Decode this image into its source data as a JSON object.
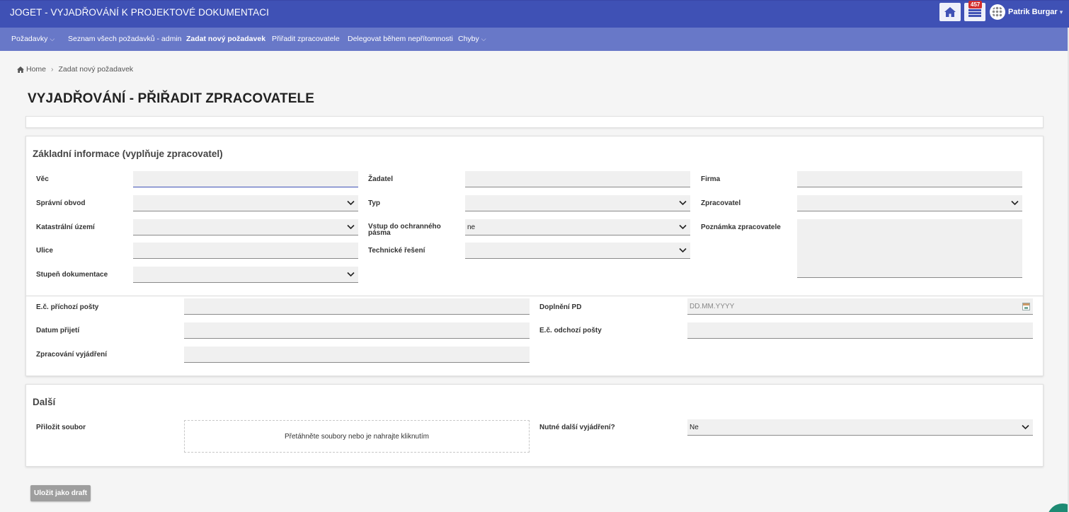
{
  "app": {
    "title": "JOGET - VYJADŘOVÁNÍ K PROJEKTOVÉ DOKUMENTACI"
  },
  "header": {
    "home_icon": "home-icon",
    "inbox_icon": "inbox-icon",
    "inbox_count": "457",
    "user_name": "Patrik Burgar"
  },
  "nav": {
    "items": [
      {
        "label": "Požadavky",
        "has_caret": true
      },
      {
        "label": "Seznam všech požadavků - admin"
      },
      {
        "label": "Zadat nový požadavek",
        "active": true
      },
      {
        "label": "Přiřadit zpracovatele"
      },
      {
        "label": "Delegovat během nepřítomnosti"
      },
      {
        "label": "Chyby",
        "has_caret": true
      }
    ]
  },
  "breadcrumb": {
    "home": "Home",
    "current": "Zadat nový požadavek"
  },
  "page": {
    "title": "VYJADŘOVÁNÍ - PŘIŘADIT ZPRACOVATELE"
  },
  "section_basic": {
    "title": "Základní informace (vyplňuje zpracovatel)",
    "labels": {
      "vec": "Věc",
      "zadatel": "Žadatel",
      "firma": "Firma",
      "spravni_obvod": "Správní obvod",
      "typ": "Typ",
      "zpracovatel": "Zpracovatel",
      "katastralni_uzemi": "Katastrální území",
      "vstup_line1": "Vstup do ochranného",
      "vstup_line2": "pásma",
      "poznamka": "Poznámka zpracovatele",
      "ulice": "Ulice",
      "technicke_reseni": "Technické řešení",
      "stupen": "Stupeň dokumentace"
    },
    "values": {
      "vstup": "ne"
    }
  },
  "section_mail": {
    "labels": {
      "ec_prichozi": "E.č. příchozí pošty",
      "doplneni_pd": "Doplnění PD",
      "datum_prijeti": "Datum přijetí",
      "ec_odchozi": "E.č. odchozí pošty",
      "zpracovani": "Zpracování vyjádření"
    },
    "placeholders": {
      "doplneni_pd": "DD.MM.YYYY"
    }
  },
  "section_other": {
    "title": "Další",
    "labels": {
      "prilozit": "Přiložit soubor",
      "nutne": "Nutné další vyjádření?"
    },
    "dropzone_text": "Přetáhněte soubory nebo je nahrajte kliknutím",
    "values": {
      "nutne": "Ne"
    }
  },
  "actions": {
    "save_draft": "Uložit jako draft"
  }
}
